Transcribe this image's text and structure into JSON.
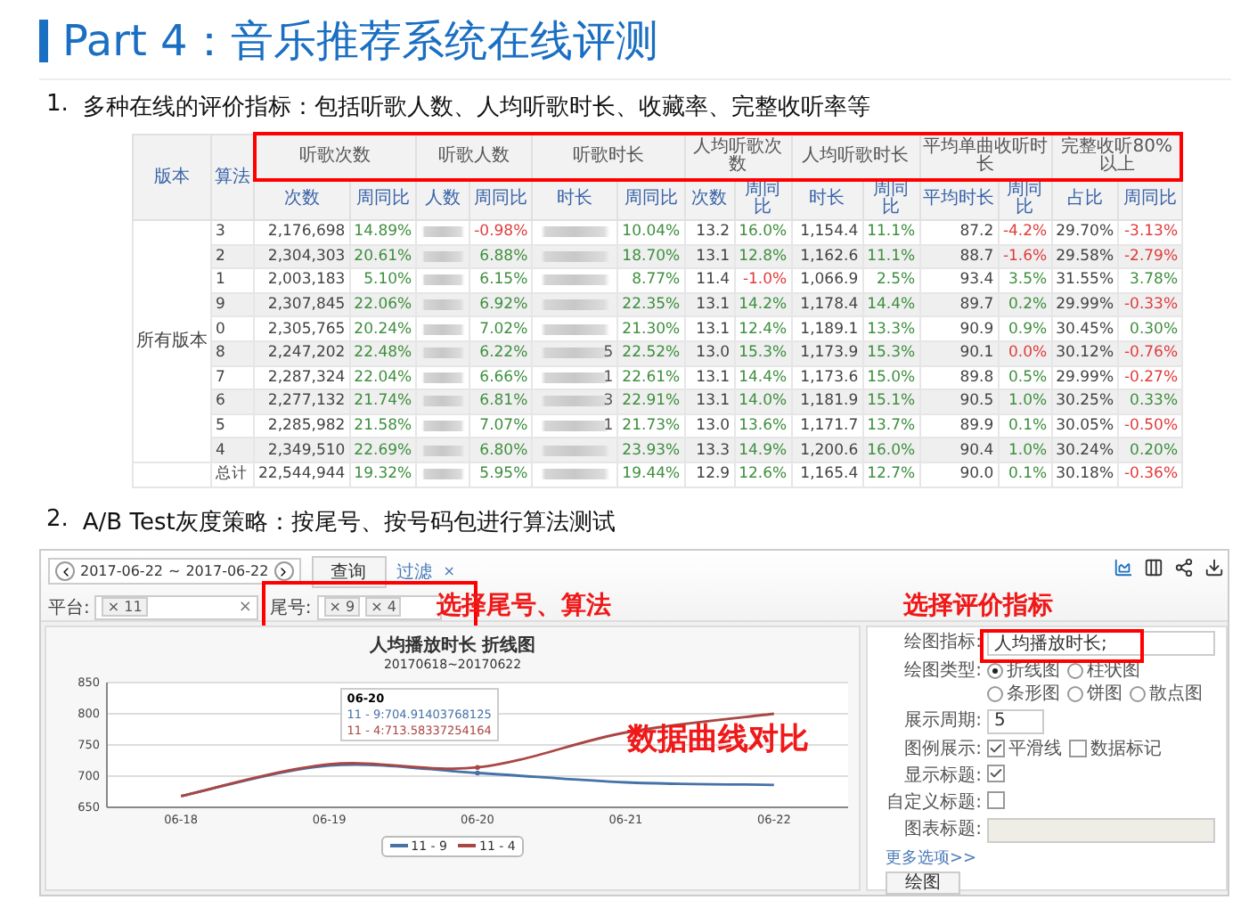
{
  "slide": {
    "title": "Part 4：音乐推荐系统在线评测"
  },
  "sections": [
    {
      "number": "1.",
      "text": "多种在线的评价指标：包括听歌人数、人均听歌时长、收藏率、完整收听率等"
    },
    {
      "number": "2.",
      "text": "A/B Test灰度策略：按尾号、按号码包进行算法测试"
    }
  ],
  "table": {
    "corner": [
      "版本",
      "算法"
    ],
    "version_label": "所有版本",
    "header_highlighted": true,
    "groups": [
      {
        "label": "听歌次数",
        "columns": [
          "次数",
          "周同比"
        ]
      },
      {
        "label": "听歌人数",
        "columns": [
          "人数",
          "周同比"
        ]
      },
      {
        "label": "听歌时长",
        "columns": [
          "时长",
          "周同比"
        ]
      },
      {
        "label": "人均听歌次数",
        "columns": [
          "次数",
          "周同比"
        ]
      },
      {
        "label": "人均听歌时长",
        "columns": [
          "时长",
          "周同比"
        ]
      },
      {
        "label": "平均单曲收听时长",
        "columns": [
          "平均时长",
          "周同比"
        ]
      },
      {
        "label": "完整收听80%以上",
        "columns": [
          "占比",
          "周同比"
        ]
      }
    ],
    "rows": [
      {
        "in_group": true,
        "algo": "3",
        "cells": [
          "2,176,698",
          {
            "text": "14.89%",
            "negative": false
          },
          {
            "blurred": true
          },
          {
            "text": "-0.98%",
            "negative": true
          },
          {
            "blurred": true
          },
          {
            "text": "10.04%",
            "negative": false
          },
          "13.2",
          {
            "text": "16.0%",
            "negative": false
          },
          "1,154.4",
          {
            "text": "11.1%",
            "negative": false
          },
          "87.2",
          {
            "text": "-4.2%",
            "negative": true
          },
          "29.70%",
          {
            "text": "-3.13%",
            "negative": true
          }
        ]
      },
      {
        "in_group": true,
        "algo": "2",
        "cells": [
          "2,304,303",
          {
            "text": "20.61%",
            "negative": false
          },
          {
            "blurred": true
          },
          {
            "text": "6.88%",
            "negative": false
          },
          {
            "blurred": true
          },
          {
            "text": "18.70%",
            "negative": false
          },
          "13.1",
          {
            "text": "12.8%",
            "negative": false
          },
          "1,162.6",
          {
            "text": "11.1%",
            "negative": false
          },
          "88.7",
          {
            "text": "-1.6%",
            "negative": true
          },
          "29.58%",
          {
            "text": "-2.79%",
            "negative": true
          }
        ]
      },
      {
        "in_group": true,
        "algo": "1",
        "cells": [
          "2,003,183",
          {
            "text": "5.10%",
            "negative": false
          },
          {
            "blurred": true
          },
          {
            "text": "6.15%",
            "negative": false
          },
          {
            "blurred": true
          },
          {
            "text": "8.77%",
            "negative": false
          },
          "11.4",
          {
            "text": "-1.0%",
            "negative": true
          },
          "1,066.9",
          {
            "text": "2.5%",
            "negative": false
          },
          "93.4",
          {
            "text": "3.5%",
            "negative": false
          },
          "31.55%",
          {
            "text": "3.78%",
            "negative": false
          }
        ]
      },
      {
        "in_group": true,
        "algo": "9",
        "cells": [
          "2,307,845",
          {
            "text": "22.06%",
            "negative": false
          },
          {
            "blurred": true
          },
          {
            "text": "6.92%",
            "negative": false
          },
          {
            "blurred": true
          },
          {
            "text": "22.35%",
            "negative": false
          },
          "13.1",
          {
            "text": "14.2%",
            "negative": false
          },
          "1,178.4",
          {
            "text": "14.4%",
            "negative": false
          },
          "89.7",
          {
            "text": "0.2%",
            "negative": false
          },
          "29.99%",
          {
            "text": "-0.33%",
            "negative": true
          }
        ]
      },
      {
        "in_group": true,
        "algo": "0",
        "cells": [
          "2,305,765",
          {
            "text": "20.24%",
            "negative": false
          },
          {
            "blurred": true
          },
          {
            "text": "7.02%",
            "negative": false
          },
          {
            "blurred": true
          },
          {
            "text": "21.30%",
            "negative": false
          },
          "13.1",
          {
            "text": "12.4%",
            "negative": false
          },
          "1,189.1",
          {
            "text": "13.3%",
            "negative": false
          },
          "90.9",
          {
            "text": "0.9%",
            "negative": false
          },
          "30.45%",
          {
            "text": "0.30%",
            "negative": false
          }
        ]
      },
      {
        "in_group": true,
        "algo": "8",
        "cells": [
          "2,247,202",
          {
            "text": "22.48%",
            "negative": false
          },
          {
            "blurred": true
          },
          {
            "text": "6.22%",
            "negative": false
          },
          {
            "blurred": true,
            "text": "5"
          },
          {
            "text": "22.52%",
            "negative": false
          },
          "13.0",
          {
            "text": "15.3%",
            "negative": false
          },
          "1,173.9",
          {
            "text": "15.3%",
            "negative": false
          },
          "90.1",
          {
            "text": "0.0%",
            "negative": true
          },
          "30.12%",
          {
            "text": "-0.76%",
            "negative": true
          }
        ]
      },
      {
        "in_group": true,
        "algo": "7",
        "cells": [
          "2,287,324",
          {
            "text": "22.04%",
            "negative": false
          },
          {
            "blurred": true
          },
          {
            "text": "6.66%",
            "negative": false
          },
          {
            "blurred": true,
            "text": "1"
          },
          {
            "text": "22.61%",
            "negative": false
          },
          "13.1",
          {
            "text": "14.4%",
            "negative": false
          },
          "1,173.6",
          {
            "text": "15.0%",
            "negative": false
          },
          "89.8",
          {
            "text": "0.5%",
            "negative": false
          },
          "29.99%",
          {
            "text": "-0.27%",
            "negative": true
          }
        ]
      },
      {
        "in_group": true,
        "algo": "6",
        "cells": [
          "2,277,132",
          {
            "text": "21.74%",
            "negative": false
          },
          {
            "blurred": true
          },
          {
            "text": "6.81%",
            "negative": false
          },
          {
            "blurred": true,
            "text": "3"
          },
          {
            "text": "22.91%",
            "negative": false
          },
          "13.1",
          {
            "text": "14.0%",
            "negative": false
          },
          "1,181.9",
          {
            "text": "15.1%",
            "negative": false
          },
          "90.5",
          {
            "text": "1.0%",
            "negative": false
          },
          "30.25%",
          {
            "text": "0.33%",
            "negative": false
          }
        ]
      },
      {
        "in_group": true,
        "algo": "5",
        "cells": [
          "2,285,982",
          {
            "text": "21.58%",
            "negative": false
          },
          {
            "blurred": true
          },
          {
            "text": "7.07%",
            "negative": false
          },
          {
            "blurred": true,
            "text": "1"
          },
          {
            "text": "21.73%",
            "negative": false
          },
          "13.0",
          {
            "text": "13.6%",
            "negative": false
          },
          "1,171.7",
          {
            "text": "13.7%",
            "negative": false
          },
          "89.9",
          {
            "text": "0.1%",
            "negative": false
          },
          "30.05%",
          {
            "text": "-0.50%",
            "negative": true
          }
        ]
      },
      {
        "in_group": true,
        "algo": "4",
        "cells": [
          "2,349,510",
          {
            "text": "22.69%",
            "negative": false
          },
          {
            "blurred": true
          },
          {
            "text": "6.80%",
            "negative": false
          },
          {
            "blurred": true
          },
          {
            "text": "23.93%",
            "negative": false
          },
          "13.3",
          {
            "text": "14.9%",
            "negative": false
          },
          "1,200.6",
          {
            "text": "16.0%",
            "negative": false
          },
          "90.4",
          {
            "text": "1.0%",
            "negative": false
          },
          "30.24%",
          {
            "text": "0.20%",
            "negative": false
          }
        ]
      },
      {
        "in_group": false,
        "algo": "总计",
        "cells": [
          "22,544,944",
          {
            "text": "19.32%",
            "negative": false
          },
          {
            "blurred": true
          },
          {
            "text": "5.95%",
            "negative": false
          },
          {
            "blurred": true
          },
          {
            "text": "19.44%",
            "negative": false
          },
          "12.9",
          {
            "text": "12.6%",
            "negative": false
          },
          "1,165.4",
          {
            "text": "12.7%",
            "negative": false
          },
          "90.0",
          {
            "text": "0.1%",
            "negative": false
          },
          "30.18%",
          {
            "text": "-0.36%",
            "negative": true
          }
        ]
      }
    ]
  },
  "abtest": {
    "date_range": {
      "start": "2017-06-22",
      "separator": "~",
      "end": "2017-06-22"
    },
    "query_button": "查询",
    "filter_link": "过滤",
    "filter_close": "×",
    "filters": [
      {
        "label": "平台:",
        "tags": [
          "× 11"
        ],
        "clear": "×",
        "highlighted": false
      },
      {
        "label": "尾号:",
        "tags": [
          "× 9",
          "× 4"
        ],
        "highlighted": true
      }
    ],
    "annotations": [
      "选择尾号、算法",
      "选择评价指标",
      "数据曲线对比"
    ],
    "chart": {
      "title": "人均播放时长 折线图",
      "subtitle": "20170618~20170622",
      "chart_data": {
        "type": "line",
        "grid": true,
        "categories": [
          "06-18",
          "06-19",
          "06-20",
          "06-21",
          "06-22"
        ],
        "ylim": [
          650,
          850
        ],
        "yticks": [
          650,
          700,
          750,
          800,
          850
        ],
        "series": [
          {
            "name": "11 - 9",
            "color": "#4572a7",
            "values": [
              668,
              717,
              705,
              690,
              686
            ]
          },
          {
            "name": "11 - 4",
            "color": "#aa4643",
            "values": [
              668,
              719,
              714,
              770,
              800
            ]
          }
        ]
      },
      "tooltip": {
        "title": "06-20",
        "lines": [
          "11 - 9:704.91403768125",
          "11 - 4:713.58337254164"
        ]
      }
    },
    "form": {
      "fields": [
        {
          "kind": "text",
          "label": "绘图指标:",
          "value": "人均播放时长;",
          "highlighted": true
        },
        {
          "kind": "radio",
          "label": "绘图类型:",
          "options": [
            {
              "label": "折线图",
              "selected": true
            },
            {
              "label": "柱状图",
              "selected": false
            },
            {
              "label": "条形图",
              "selected": false
            },
            {
              "label": "饼图",
              "selected": false
            },
            {
              "label": "散点图",
              "selected": false
            }
          ]
        },
        {
          "kind": "text",
          "label": "展示周期:",
          "value": "5",
          "highlighted": false
        },
        {
          "kind": "checks",
          "label": "图例展示:",
          "options": [
            {
              "label": "平滑线",
              "checked": true
            },
            {
              "label": "数据标记",
              "checked": false
            }
          ]
        },
        {
          "kind": "checks",
          "label": "显示标题:",
          "options": [
            {
              "checked": true
            }
          ]
        },
        {
          "kind": "checks",
          "label": "自定义标题:",
          "options": [
            {
              "checked": false
            }
          ]
        },
        {
          "kind": "text",
          "label": "图表标题:",
          "disabled": true,
          "highlighted": false
        }
      ],
      "more_link": "更多选项>>",
      "draw_button": "绘图"
    }
  }
}
